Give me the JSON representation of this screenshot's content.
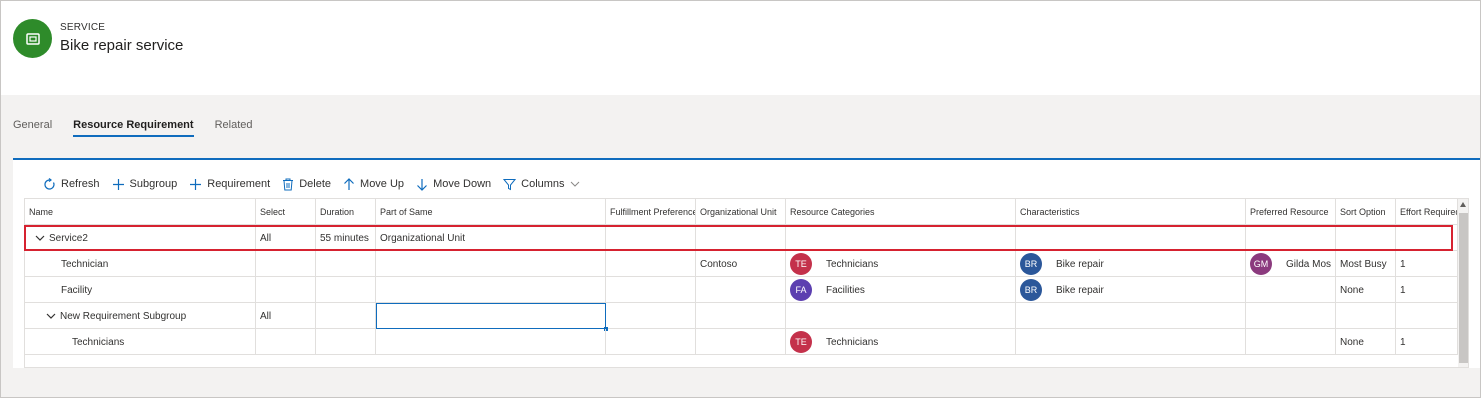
{
  "header": {
    "entity_type": "SERVICE",
    "title": "Bike repair service",
    "icon": "service-icon",
    "icon_color": "#2e8b2a"
  },
  "tabs": [
    {
      "label": "General",
      "active": false
    },
    {
      "label": "Resource Requirement",
      "active": true
    },
    {
      "label": "Related",
      "active": false
    }
  ],
  "toolbar": {
    "refresh": "Refresh",
    "subgroup": "Subgroup",
    "requirement": "Requirement",
    "delete": "Delete",
    "move_up": "Move Up",
    "move_down": "Move Down",
    "columns": "Columns"
  },
  "grid": {
    "columns": [
      "Name",
      "Select",
      "Duration",
      "Part of Same",
      "Fulfillment Preference",
      "Organizational Unit",
      "Resource Categories",
      "Characteristics",
      "Preferred Resource",
      "Sort Option",
      "Effort Required"
    ],
    "rows": [
      {
        "name": "Service2",
        "expandable": true,
        "select": "All",
        "duration": "55 minutes",
        "part_of_same": "Organizational Unit",
        "org_unit": "",
        "category": "",
        "category_initials": "",
        "characteristic": "",
        "characteristic_initials": "",
        "preferred": "",
        "preferred_initials": "",
        "sort": "",
        "effort": ""
      },
      {
        "name": "Technician",
        "expandable": false,
        "select": "",
        "duration": "",
        "part_of_same": "",
        "org_unit": "Contoso",
        "category": "Technicians",
        "category_initials": "TE",
        "characteristic": "Bike repair",
        "characteristic_initials": "BR",
        "preferred": "Gilda Mos",
        "preferred_initials": "GM",
        "sort": "Most Busy",
        "effort": "1"
      },
      {
        "name": "Facility",
        "expandable": false,
        "select": "",
        "duration": "",
        "part_of_same": "",
        "org_unit": "",
        "category": "Facilities",
        "category_initials": "FA",
        "characteristic": "Bike repair",
        "characteristic_initials": "BR",
        "preferred": "",
        "preferred_initials": "",
        "sort": "None",
        "effort": "1"
      },
      {
        "name": "New Requirement Subgroup",
        "expandable": true,
        "select": "All",
        "duration": "",
        "part_of_same": "",
        "org_unit": "",
        "category": "",
        "category_initials": "",
        "characteristic": "",
        "characteristic_initials": "",
        "preferred": "",
        "preferred_initials": "",
        "sort": "",
        "effort": ""
      },
      {
        "name": "Technicians",
        "expandable": false,
        "select": "",
        "duration": "",
        "part_of_same": "",
        "org_unit": "",
        "category": "Technicians",
        "category_initials": "TE",
        "characteristic": "",
        "characteristic_initials": "",
        "preferred": "",
        "preferred_initials": "",
        "sort": "None",
        "effort": "1"
      }
    ]
  },
  "colors": {
    "accent": "#0f6cbd",
    "highlight": "#d62230",
    "avatar_te": "#c4314b",
    "avatar_fa": "#5c3fb0",
    "avatar_br": "#2b579a",
    "avatar_gm": "#8b3a7e"
  }
}
